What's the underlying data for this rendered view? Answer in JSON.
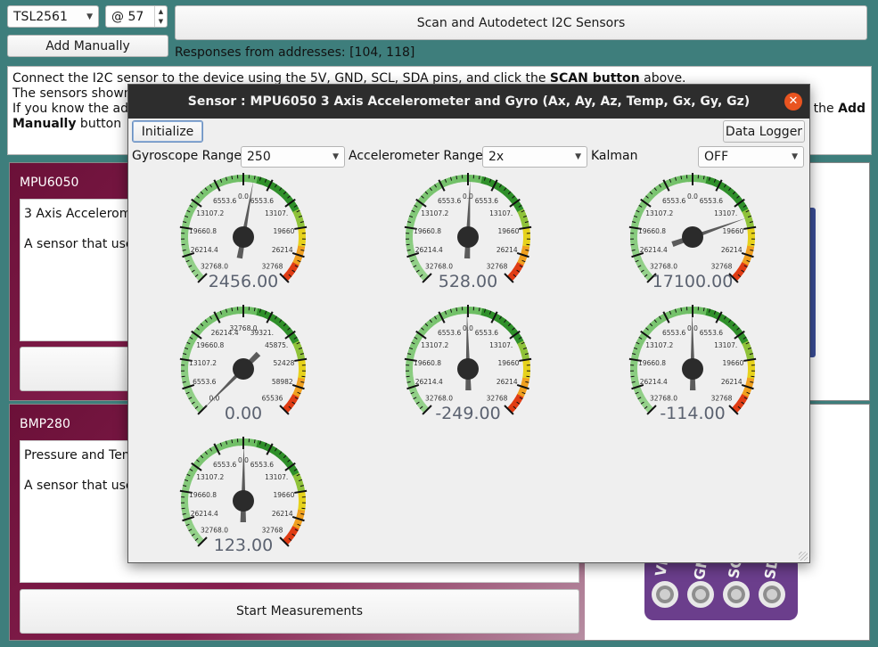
{
  "toolbar": {
    "sensor_select": "TSL2561",
    "address_value": "@ 57",
    "scan_button": "Scan and Autodetect I2C Sensors",
    "add_manually_button": "Add Manually",
    "responses": "Responses from addresses: [104, 118]"
  },
  "instructions": {
    "line1_pre": "Connect the I2C sensor to the device using the 5V, GND, SCL, SDA pins, and click the ",
    "line1_bold": "SCAN button",
    "line1_post": " above.",
    "line2": "The sensors shown",
    "line3_pre": "If you know the add",
    "line3_bold": "Add",
    "line3_end": "the",
    "line4_bold": "Manually",
    "line4_post": " button"
  },
  "cards": [
    {
      "title": "MPU6050",
      "desc1": "3 Axis Acceleromet",
      "desc2": "A sensor that use"
    },
    {
      "title": "BMP280",
      "desc1": "Pressure and Tem",
      "desc2": "A sensor that use",
      "button": "Start Measurements"
    }
  ],
  "breakout_pins": [
    "VI",
    "GN",
    "SC",
    "SD"
  ],
  "dialog": {
    "title": "Sensor : MPU6050 3 Axis Accelerometer and Gyro (Ax, Ay, Az, Temp, Gx, Gy, Gz)",
    "close_icon": "close-icon",
    "initialize_button": "Initialize",
    "data_logger_button": "Data Logger",
    "gyro_range_label": "Gyroscope Range",
    "gyro_range_value": "250",
    "accel_range_label": "Accelerometer Range",
    "accel_range_value": "2x",
    "kalman_label": "Kalman",
    "kalman_value": "OFF"
  },
  "gauges": [
    {
      "value": 2456.0,
      "display": "2456.00",
      "min": -32768,
      "max": 32768,
      "ticks": [
        "32768.0",
        "26214.4",
        "19660.8",
        "13107.2",
        "6553.6",
        "0.0",
        "6553.6",
        "13107.",
        "19660",
        "26214",
        "32768"
      ]
    },
    {
      "value": 528.0,
      "display": "528.00",
      "min": -32768,
      "max": 32768,
      "ticks": [
        "32768.0",
        "26214.4",
        "19660.8",
        "13107.2",
        "6553.6",
        "0.0",
        "6553.6",
        "13107.",
        "19660",
        "26214",
        "32768"
      ]
    },
    {
      "value": 17100.0,
      "display": "17100.00",
      "min": -32768,
      "max": 32768,
      "ticks": [
        "32768.0",
        "26214.4",
        "19660.8",
        "13107.2",
        "6553.6",
        "0.0",
        "6553.6",
        "13107.",
        "19660",
        "26214",
        "32768"
      ]
    },
    {
      "value": 0.0,
      "display": "0.00",
      "min": 0,
      "max": 65536,
      "ticks": [
        "0.0",
        "6553.6",
        "13107.2",
        "19660.8",
        "26214.4",
        "32768.0",
        "39321.",
        "45875.",
        "52428",
        "58982",
        "65536"
      ]
    },
    {
      "value": -249.0,
      "display": "-249.00",
      "min": -32768,
      "max": 32768,
      "ticks": [
        "32768.0",
        "26214.4",
        "19660.8",
        "13107.2",
        "6553.6",
        "0.0",
        "6553.6",
        "13107.",
        "19660",
        "26214",
        "32768"
      ]
    },
    {
      "value": -114.0,
      "display": "-114.00",
      "min": -32768,
      "max": 32768,
      "ticks": [
        "32768.0",
        "26214.4",
        "19660.8",
        "13107.2",
        "6553.6",
        "0.0",
        "6553.6",
        "13107.",
        "19660",
        "26214",
        "32768"
      ]
    },
    {
      "value": 123.0,
      "display": "123.00",
      "min": -32768,
      "max": 32768,
      "ticks": [
        "32768.0",
        "26214.4",
        "19660.8",
        "13107.2",
        "6553.6",
        "0.0",
        "6553.6",
        "13107.",
        "19660",
        "26214",
        "32768"
      ]
    }
  ]
}
